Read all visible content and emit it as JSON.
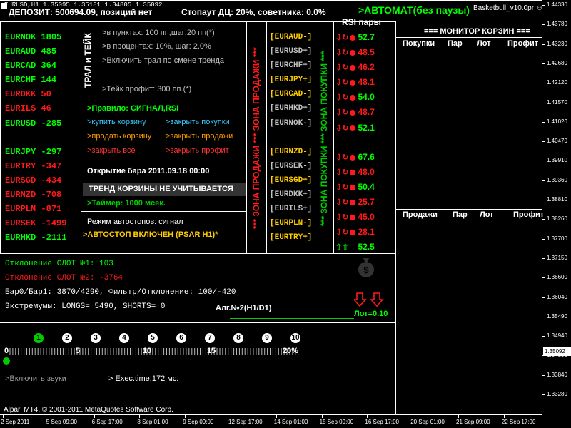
{
  "header": {
    "chart_title": "EURUSD,H1  1.35095 1.35181 1.34805 1.35092",
    "deposit": "ДЕПОЗИТ: 500694.09, позиций нет",
    "stopout": "Стопаут ДЦ: 20%, советника: 0.0%",
    "mode": ">АВТОМАТ(без паузы)",
    "expert_name": "Basketbull_v10.0pr"
  },
  "pairs_left": [
    {
      "name": "EURNOK",
      "value": "1805",
      "color": "#00ff00"
    },
    {
      "name": "EURAUD",
      "value": "485",
      "color": "#00ff00"
    },
    {
      "name": "EURCAD",
      "value": "364",
      "color": "#00ff00"
    },
    {
      "name": "EURCHF",
      "value": "144",
      "color": "#00ff00"
    },
    {
      "name": "EURDKK",
      "value": "50",
      "color": "#ff1a1a"
    },
    {
      "name": "EURILS",
      "value": "46",
      "color": "#ff1a1a"
    },
    {
      "name": "EURUSD",
      "value": "-285",
      "color": "#00ff00"
    },
    {
      "name": "EURJPY",
      "value": "-297",
      "color": "#00ff00"
    },
    {
      "name": "EURTRY",
      "value": "-347",
      "color": "#ff1a1a"
    },
    {
      "name": "EURSGD",
      "value": "-434",
      "color": "#ff1a1a"
    },
    {
      "name": "EURNZD",
      "value": "-708",
      "color": "#ff1a1a"
    },
    {
      "name": "EURPLN",
      "value": "-871",
      "color": "#ff1a1a"
    },
    {
      "name": "EURSEK",
      "value": "-1499",
      "color": "#ff1a1a"
    },
    {
      "name": "EURHKD",
      "value": "-2111",
      "color": "#00ff00"
    }
  ],
  "trail": {
    "vertical_label": "ТРАЛ и ТЕЙК",
    "points": ">в пунктах: 100 пп,шаг:20 пп(*)",
    "percent": ">в процентах: 10%, шаг: 2.0%",
    "trend": ">Включить трал по смене тренда",
    "takeprofit": ">Тейк профит: 300 пп.(*)"
  },
  "controls": {
    "rule": ">Правило: СИГНАЛ,RSI",
    "buy_basket": ">купить корзину",
    "close_buys": ">закрыть покупки",
    "sell_basket": ">продать корзину",
    "close_sells": ">закрыть продажи",
    "close_all": ">закрыть все",
    "close_profit": ">закрыть профит",
    "bar_open": "Открытие бара 2011.09.18 00:00",
    "trend_note": "ТРЕНД КОРЗИНЫ НЕ УЧИТЫВАЕТСЯ",
    "timer": ">Таймер: 1000 мсек.",
    "autostop_mode": "Режим автостопов: сигнал",
    "autostop_on": ">АВТОСТОП ВКЛЮЧЕН (PSAR H1)*"
  },
  "zones": {
    "sell_label": "*** ЗОНА ПРОДАЖИ *** ЗОНА ПРОДАЖИ ***",
    "buy_label": "*** ЗОНА ПОКУПКИ *** ЗОНА ПОКУПКИ ***",
    "rsi_header": "RSI пары",
    "rows": [
      {
        "pair": "[EURAUD-]",
        "color": "#ffcc00",
        "arrow": "⇩↻",
        "rsi": "52.7",
        "rsi_color": "#00ff00"
      },
      {
        "pair": "[EURUSD+]",
        "color": "#c0c0c0",
        "arrow": "⇩↻",
        "rsi": "48.5",
        "rsi_color": "#ff1a1a"
      },
      {
        "pair": "[EURCHF+]",
        "color": "#c0c0c0",
        "arrow": "⇩↻",
        "rsi": "46.2",
        "rsi_color": "#ff1a1a"
      },
      {
        "pair": "[EURJPY+]",
        "color": "#ffcc00",
        "arrow": "⇩↻",
        "rsi": "48.1",
        "rsi_color": "#ff1a1a"
      },
      {
        "pair": "[EURCAD-]",
        "color": "#ffcc00",
        "arrow": "⇩↻",
        "rsi": "54.0",
        "rsi_color": "#00ff00"
      },
      {
        "pair": "[EURHKD+]",
        "color": "#c0c0c0",
        "arrow": "⇩↻",
        "rsi": "48.7",
        "rsi_color": "#ff1a1a"
      },
      {
        "pair": "[EURNOK-]",
        "color": "#c0c0c0",
        "arrow": "⇩↻",
        "rsi": "52.1",
        "rsi_color": "#00ff00"
      },
      {
        "pair": "[EURNZD-]",
        "color": "#ffcc00",
        "arrow": "⇩↻",
        "rsi": "67.6",
        "rsi_color": "#00ff00"
      },
      {
        "pair": "[EURSEK-]",
        "color": "#c0c0c0",
        "arrow": "⇩↻",
        "rsi": "48.0",
        "rsi_color": "#ff1a1a"
      },
      {
        "pair": "[EURSGD+]",
        "color": "#ffcc00",
        "arrow": "⇩↻",
        "rsi": "50.4",
        "rsi_color": "#00ff00"
      },
      {
        "pair": "[EURDKK+]",
        "color": "#c0c0c0",
        "arrow": "⇩↻",
        "rsi": "25.7",
        "rsi_color": "#ff1a1a"
      },
      {
        "pair": "[EURILS+]",
        "color": "#c0c0c0",
        "arrow": "⇩↻",
        "rsi": "45.0",
        "rsi_color": "#ff1a1a"
      },
      {
        "pair": "[EURPLN-]",
        "color": "#ffcc00",
        "arrow": "⇩↻",
        "rsi": "28.1",
        "rsi_color": "#ff1a1a"
      },
      {
        "pair": "[EURTRY+]",
        "color": "#ffcc00",
        "arrow": "⇧⇧",
        "rsi": "52.5",
        "rsi_color": "#00ff00"
      }
    ]
  },
  "monitor": {
    "title": "=== МОНИТОР КОРЗИН ===",
    "buy_cols": [
      "Покупки",
      "Пар",
      "Лот",
      "Профит"
    ],
    "sell_cols": [
      "Продажи",
      "Пар",
      "Лот",
      "Профит"
    ]
  },
  "stats": {
    "slot1": "Отклонение СЛОТ №1: 103",
    "slot2": "Отклонение СЛОТ №2: -3764",
    "bars": "Бар0/Бар1: 3870/4290, Фильтр/Отклонение: 100/-420",
    "extremes": "Экстремумы: LONGS= 5490, SHORTS= 0",
    "algorithm": "Алг.№2(H1/D1)",
    "lot": "Лот=0.10"
  },
  "progress": {
    "steps": [
      "1",
      "2",
      "3",
      "4",
      "5",
      "6",
      "7",
      "8",
      "9",
      "10"
    ],
    "scale_0": "0",
    "scale_5": "5",
    "scale_10": "10",
    "scale_15": "15",
    "scale_20": "20%",
    "level_percent": 0
  },
  "footer": {
    "sounds": ">Включить звуки",
    "exec": "> Exec.time:172 мс.",
    "copyright": "Alpari MT4, © 2001-2011 MetaQuotes Software Corp."
  },
  "price_axis": [
    "1.44330",
    "1.43780",
    "1.43230",
    "1.42680",
    "1.42120",
    "1.41570",
    "1.41020",
    "1.40470",
    "1.39910",
    "1.39360",
    "1.38810",
    "1.38260",
    "1.37700",
    "1.37150",
    "1.36600",
    "1.36040",
    "1.35490",
    "1.35092",
    "1.34940",
    "1.34390",
    "1.33840",
    "1.33280"
  ],
  "current_price": "1.35092",
  "time_axis": [
    "2 Sep 2011",
    "5 Sep 09:00",
    "6 Sep 17:00",
    "8 Sep 01:00",
    "9 Sep 09:00",
    "12 Sep 17:00",
    "14 Sep 01:00",
    "15 Sep 09:00",
    "16 Sep 17:00",
    "20 Sep 01:00",
    "21 Sep 09:00",
    "22 Sep 17:00"
  ]
}
